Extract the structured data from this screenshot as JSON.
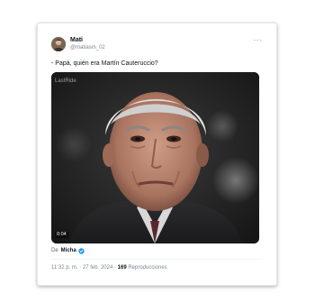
{
  "tweet": {
    "author": {
      "display_name": "Mati",
      "handle": "@matiasm_02"
    },
    "more_icon": "more-horizontal-icon",
    "text": "- Papá, quién era Martín Cauteruccio?",
    "media": {
      "watermark": "LastRide",
      "duration": "0:04"
    },
    "source": {
      "prefix": "De",
      "name": "Micha",
      "verified_color": "#1d9bf0"
    },
    "meta": {
      "time": "11:32 p. m.",
      "separator1": " · ",
      "date": "27 feb. 2024",
      "separator2": " · ",
      "views_count": "169",
      "views_label": " Reproducciones"
    }
  }
}
